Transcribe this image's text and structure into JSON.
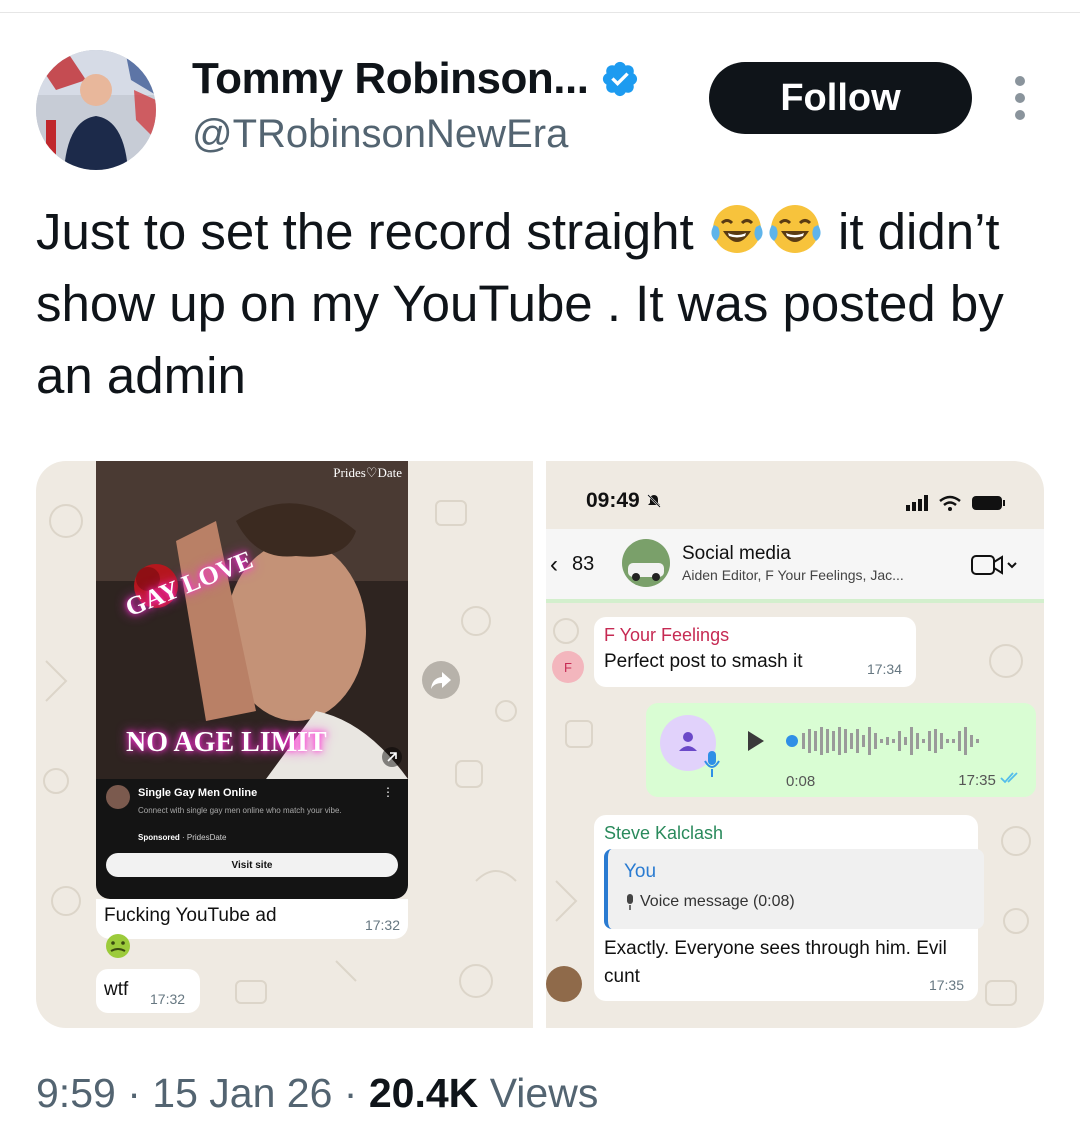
{
  "author": {
    "display_name": "Tommy Robinson...",
    "handle": "@TRobinsonNewEra",
    "verified": true
  },
  "actions": {
    "follow_label": "Follow"
  },
  "tweet": {
    "text_part1": "Just to set the record straight",
    "text_part2": " it didn’t show up on my YouTube . It was posted by an admin",
    "emojis": [
      "face-with-tears-of-joy",
      "face-with-tears-of-joy"
    ]
  },
  "media": {
    "left": {
      "ad": {
        "brand": "Prides♡Date",
        "overlay_top": "GAY LOVE",
        "overlay_bottom": "NO AGE LIMIT",
        "title": "Single Gay Men Online",
        "description": "Connect with single gay men online who match your vibe.",
        "sponsored": "Sponsored",
        "sponsor_name": "· PridesDate",
        "cta": "Visit site"
      },
      "messages": [
        {
          "text": "Fucking YouTube ad",
          "time": "17:32"
        },
        {
          "text": "wtf",
          "time": "17:32"
        }
      ]
    },
    "right": {
      "status_time": "09:49",
      "header": {
        "back_count": "83",
        "group_name": "Social media",
        "members": "Aiden Editor, F Your Feelings, Jac..."
      },
      "msg1": {
        "sender": "F Your Feelings",
        "avatar_letter": "F",
        "text": "Perfect post to smash it",
        "time": "17:34"
      },
      "voice": {
        "duration": "0:08",
        "time": "17:35"
      },
      "msg3": {
        "sender": "Steve Kalclash",
        "quote_name": "You",
        "quote_text": "Voice message (0:08)",
        "text": "Exactly. Everyone sees through him. Evil cunt",
        "time": "17:35"
      }
    }
  },
  "footer": {
    "time": "9:59",
    "date": "15 Jan 26",
    "views_count": "20.4K",
    "views_label": "Views"
  },
  "colors": {
    "follow_bg": "#0f1419",
    "verified": "#1d9bf0",
    "chat_bg": "#efeae2",
    "outgoing_bubble": "#d9fdd3"
  }
}
